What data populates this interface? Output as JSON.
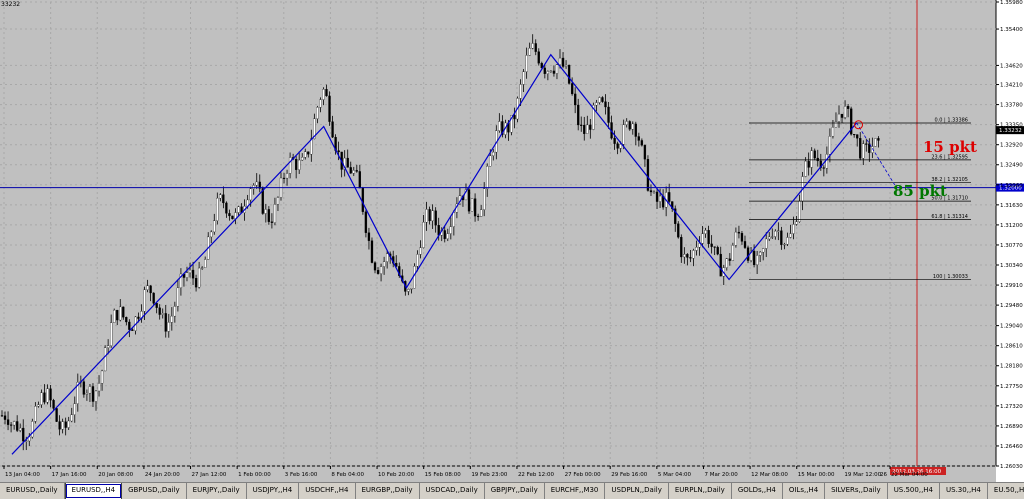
{
  "window": {
    "symbol_label": "33232"
  },
  "chart_data": {
    "type": "candlestick",
    "symbol": "EURUSD,H4",
    "ylim": [
      1.2603,
      1.3598
    ],
    "y_ticks": [
      "1.35980",
      "1.35400",
      "1.34620",
      "1.34210",
      "1.33780",
      "1.33350",
      "1.32920",
      "1.32490",
      "1.32060",
      "1.31630",
      "1.31200",
      "1.30770",
      "1.30340",
      "1.29910",
      "1.29480",
      "1.29040",
      "1.28610",
      "1.28180",
      "1.27750",
      "1.27320",
      "1.26890",
      "1.26460",
      "1.26030"
    ],
    "x_ticks": [
      "13 Jan 04:00",
      "17 Jan 16:00",
      "20 Jan 08:00",
      "24 Jan 20:00",
      "27 Jan 12:00",
      "1 Feb 00:00",
      "3 Feb 16:00",
      "8 Feb 04:00",
      "10 Feb 20:00",
      "15 Feb 08:00",
      "19 Feb 23:00",
      "22 Feb 12:00",
      "27 Feb 00:00",
      "29 Feb 16:00",
      "5 Mar 04:00",
      "7 Mar 20:00",
      "12 Mar 08:00",
      "15 Mar 00:00",
      "19 Mar 12:00",
      "22 Mar 04:00"
    ],
    "current_price": "1.33232",
    "horizontal_line_price": "1.32000",
    "time_marker": "2012.03.26 16:00",
    "time_marker_short": "26",
    "zigzag": [
      {
        "bar": 0.012,
        "price": 1.2628
      },
      {
        "bar": 0.325,
        "price": 1.3331
      },
      {
        "bar": 0.408,
        "price": 1.2985
      },
      {
        "bar": 0.553,
        "price": 1.3485
      },
      {
        "bar": 0.732,
        "price": 1.3003
      },
      {
        "bar": 0.86,
        "price": 1.3339
      }
    ],
    "projection": [
      {
        "bar": 0.86,
        "price": 1.3339
      },
      {
        "bar": 0.9,
        "price": 1.32
      }
    ],
    "fibonacci": [
      {
        "level": "0.0",
        "price": 1.33386,
        "label": "1.33386"
      },
      {
        "level": "23.6",
        "price": 1.32595,
        "label": "1.32595"
      },
      {
        "level": "38.2",
        "price": 1.32105,
        "label": "1.32105"
      },
      {
        "level": "50.0",
        "price": 1.3171,
        "label": "1.31710"
      },
      {
        "level": "61.8",
        "price": 1.31314,
        "label": "1.31314"
      },
      {
        "level": "100",
        "price": 1.30033,
        "label": "1.30033"
      }
    ],
    "annotations": [
      {
        "text": "15 pkt",
        "color": "#dd0000"
      },
      {
        "text": "85 pkt",
        "color": "#007700"
      }
    ]
  },
  "tabs": [
    "EURUSD,,Daily",
    "EURUSD,,H4",
    "GBPUSD,,Daily",
    "EURJPY,,Daily",
    "USDJPY,,H4",
    "USDCHF,,H4",
    "EURGBP,,Daily",
    "USDCAD,,Daily",
    "GBPJPY,,Daily",
    "EURCHF,,M30",
    "USDPLN,,Daily",
    "EURPLN,,Daily",
    "GOLDs,,H4",
    "OILs,,H4",
    "SILVERs,,Daily",
    "US.500,,H4",
    "US.30,,H4",
    "EU.50,,H4"
  ],
  "active_tab_index": 1
}
